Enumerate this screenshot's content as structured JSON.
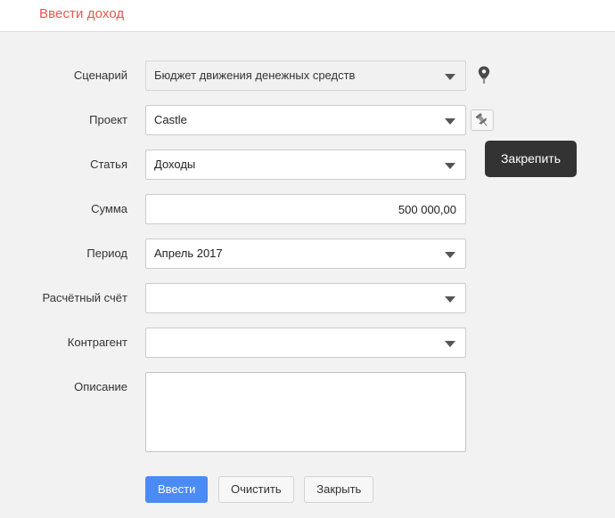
{
  "header": {
    "title": "Ввести доход",
    "title_color": "#e8564c"
  },
  "form": {
    "fields": [
      {
        "label": "Сценарий",
        "type": "select",
        "value": "Бюджет движения денежных средств",
        "disabled": true
      },
      {
        "label": "Проект",
        "type": "select",
        "value": "Castle",
        "disabled": false
      },
      {
        "label": "Статья",
        "type": "select",
        "value": "Доходы",
        "disabled": false
      },
      {
        "label": "Сумма",
        "type": "text",
        "value": "500 000,00",
        "placeholder": ""
      },
      {
        "label": "Период",
        "type": "select",
        "value": "Апрель 2017",
        "disabled": false
      },
      {
        "label": "Расчётный счёт",
        "type": "select",
        "value": "",
        "disabled": false
      },
      {
        "label": "Контрагент",
        "type": "select",
        "value": "",
        "disabled": false
      },
      {
        "label": "Описание",
        "type": "textarea",
        "value": "",
        "placeholder": ""
      }
    ]
  },
  "icons": {
    "scenario_marker": "map-pin-icon",
    "project_pin": "pushpin-icon"
  },
  "tooltip": {
    "text": "Закрепить"
  },
  "buttons": {
    "submit": "Ввести",
    "clear": "Очистить",
    "close": "Закрыть",
    "primary_color": "#4a8bf5"
  }
}
